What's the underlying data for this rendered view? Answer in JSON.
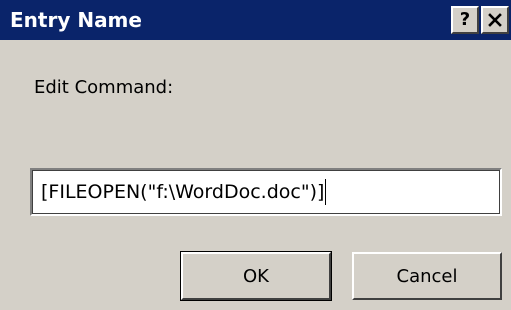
{
  "window": {
    "title": "Entry Name",
    "help_label": "?",
    "close_icon": "close-icon"
  },
  "form": {
    "prompt_label": "Edit Command:",
    "command_value": "[FILEOPEN(\"f:\\WordDoc.doc\")]"
  },
  "buttons": {
    "ok_label": "OK",
    "cancel_label": "Cancel"
  },
  "colors": {
    "titlebar": "#0a246a",
    "dialog_face": "#d4d0c8",
    "title_text": "#ffffff"
  }
}
